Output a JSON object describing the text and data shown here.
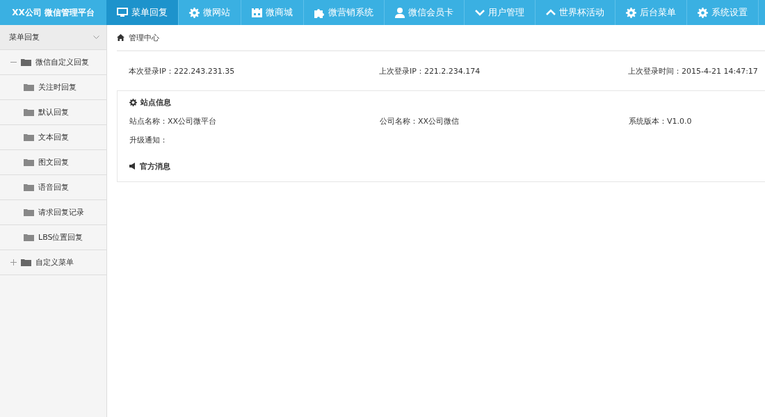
{
  "brand": "XX公司 微信管理平台",
  "nav": [
    {
      "label": "菜单回复",
      "selected": true
    },
    {
      "label": "微网站",
      "selected": false
    },
    {
      "label": "微商城",
      "selected": false
    },
    {
      "label": "微营销系统",
      "selected": false
    },
    {
      "label": "微信会员卡",
      "selected": false
    },
    {
      "label": "用户管理",
      "selected": false
    },
    {
      "label": "世界杯活动",
      "selected": false
    },
    {
      "label": "后台菜单",
      "selected": false
    },
    {
      "label": "系统设置",
      "selected": false
    }
  ],
  "sidebar": {
    "section": {
      "label": "菜单回复",
      "expanded": true
    },
    "tree": [
      {
        "label": "微信自定义回复",
        "expanded": true,
        "children": [
          {
            "label": "关注时回复"
          },
          {
            "label": "默认回复"
          },
          {
            "label": "文本回复"
          },
          {
            "label": "图文回复"
          },
          {
            "label": "语音回复"
          },
          {
            "label": "请求回复记录"
          },
          {
            "label": "LBS位置回复"
          }
        ]
      },
      {
        "label": "自定义菜单",
        "expanded": false
      }
    ]
  },
  "breadcrumb": "管理中心",
  "login_info": [
    "本次登录IP：222.243.231.35",
    "上次登录IP：221.2.234.174",
    "上次登录时间：2015-4-21 14:47:17"
  ],
  "site_info": {
    "title": "站点信息",
    "fields": [
      "站点名称：XX公司微平台",
      "公司名称：XX公司微信",
      "系统版本：V1.0.0",
      "升级通知："
    ]
  },
  "notice": {
    "title": "官方消息"
  }
}
